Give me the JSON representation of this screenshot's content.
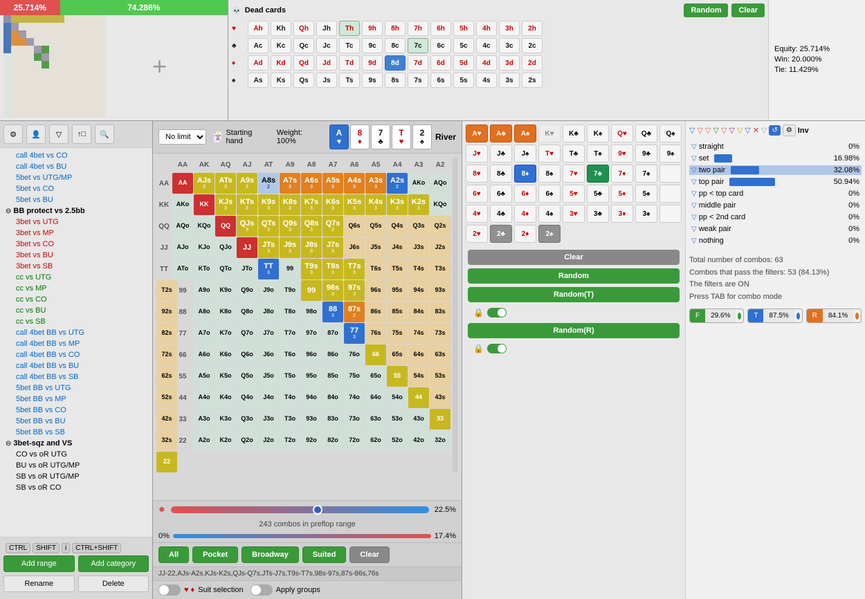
{
  "header": {
    "equity_red": "25.714%",
    "equity_green": "74.286%",
    "dead_cards_title": "Dead cards",
    "random_label": "Random",
    "clear_label": "Clear",
    "equity_label": "Equity: 25.714%",
    "win_label": "Win: 20.000%",
    "tie_label": "Tie: 11.429%"
  },
  "dead_cards": {
    "rows": [
      {
        "label": "A♠",
        "cards": [
          "Ah",
          "Kh",
          "Qh",
          "Jh",
          "Th",
          "9h",
          "8h",
          "7h",
          "6h",
          "5h",
          "4h",
          "3h",
          "2h"
        ]
      },
      {
        "label": "A♥",
        "cards": [
          "Ac",
          "Kc",
          "Qc",
          "Jc",
          "Tc",
          "9c",
          "8c",
          "7c",
          "6c",
          "5c",
          "4c",
          "3c",
          "2c"
        ]
      },
      {
        "label": "A♦",
        "cards": [
          "Ad",
          "Kd",
          "Qd",
          "Jd",
          "Td",
          "9d",
          "8d",
          "7d",
          "6d",
          "5d",
          "4d",
          "3d",
          "2d"
        ]
      },
      {
        "label": "A♣",
        "cards": [
          "As",
          "Ks",
          "Qs",
          "Js",
          "Ts",
          "9s",
          "8s",
          "7s",
          "6s",
          "5s",
          "4s",
          "3s",
          "2s"
        ]
      }
    ]
  },
  "sidebar": {
    "items": [
      {
        "label": "call 4bet vs CO",
        "class": "blue indent2"
      },
      {
        "label": "call 4bet vs BU",
        "class": "blue indent2"
      },
      {
        "label": "5bet vs UTG/MP",
        "class": "blue indent2"
      },
      {
        "label": "5bet vs CO",
        "class": "blue indent2"
      },
      {
        "label": "5bet vs BU",
        "class": "blue indent2"
      },
      {
        "label": "BB protect vs 2.5bb",
        "class": "category"
      },
      {
        "label": "3bet vs UTG",
        "class": "red indent2"
      },
      {
        "label": "3bet vs MP",
        "class": "red indent2"
      },
      {
        "label": "3bet vs CO",
        "class": "red indent2"
      },
      {
        "label": "3bet vs BU",
        "class": "red indent2"
      },
      {
        "label": "3bet vs SB",
        "class": "red indent2"
      },
      {
        "label": "cc vs UTG",
        "class": "green indent2"
      },
      {
        "label": "cc vs MP",
        "class": "green indent2"
      },
      {
        "label": "cc vs CO",
        "class": "green indent2"
      },
      {
        "label": "cc vs BU",
        "class": "green indent2"
      },
      {
        "label": "cc vs SB",
        "class": "green indent2"
      },
      {
        "label": "call 4bet BB vs UTG",
        "class": "blue indent2"
      },
      {
        "label": "call 4bet BB vs MP",
        "class": "blue indent2"
      },
      {
        "label": "call 4bet BB vs CO",
        "class": "blue indent2"
      },
      {
        "label": "call 4bet BB vs BU",
        "class": "blue indent2"
      },
      {
        "label": "call 4bet BB vs SB",
        "class": "blue indent2"
      },
      {
        "label": "5bet BB vs UTG",
        "class": "blue indent2"
      },
      {
        "label": "5bet BB vs MP",
        "class": "blue indent2"
      },
      {
        "label": "5bet BB vs CO",
        "class": "blue indent2"
      },
      {
        "label": "5bet BB vs BU",
        "class": "blue indent2"
      },
      {
        "label": "5bet BB vs SB",
        "class": "blue indent2"
      },
      {
        "label": "3bet-sqz and VS",
        "class": "category"
      },
      {
        "label": "CO vs oR UTG",
        "class": "indent2"
      },
      {
        "label": "BU vs oR UTG/MP",
        "class": "indent2"
      },
      {
        "label": "SB vs oR UTG/MP",
        "class": "indent2"
      },
      {
        "label": "SB vs oR CO",
        "class": "indent2"
      }
    ],
    "add_range": "Add range",
    "add_category": "Add category",
    "rename": "Rename",
    "delete": "Delete"
  },
  "range_editor": {
    "limit_label": "No limit",
    "starting_hand_label": "Starting hand",
    "weight_label": "Weight:",
    "weight_value": "100%",
    "river_label": "River",
    "combos_label": "243 combos in preflop range",
    "percent_label": "22.5%",
    "range_0": "0%",
    "range_17": "17.4%",
    "all_label": "All",
    "pocket_label": "Pocket",
    "broadway_label": "Broadway",
    "suited_label": "Suited",
    "clear_range_label": "Clear",
    "combo_text": "JJ-22,AJs-A2s,KJs-K2s,QJs-Q7s,JTs-J7s,T9s-T7s,98s-97s,87s-86s,76s",
    "suit_selection_label": "Suit selection",
    "apply_groups_label": "Apply groups"
  },
  "hand_grid": {
    "headers": [
      "AA",
      "AK",
      "AQ",
      "AJ",
      "AT",
      "A9",
      "A8",
      "A7",
      "A6",
      "A5",
      "A4",
      "A3",
      "A2"
    ],
    "rows_labels": [
      "AA",
      "KK",
      "QQ",
      "JJ",
      "TT",
      "99",
      "88",
      "77",
      "66",
      "55",
      "44",
      "33",
      "22"
    ],
    "cells": {
      "AA": {
        "label": "AA",
        "type": "pair",
        "color": "pair"
      },
      "AKs": {
        "label": "AJs",
        "sub": "3",
        "type": "suited",
        "color": "yellow"
      },
      "AQs": {
        "label": "ATs",
        "sub": "3",
        "type": "suited",
        "color": "yellow"
      },
      "AJs": {
        "label": "A9s",
        "sub": "3",
        "type": "suited",
        "color": "yellow"
      },
      "ATs": {
        "label": "A8s",
        "sub": "2",
        "type": "suited",
        "color": "blue-green"
      },
      "A9s": {
        "label": "A7s",
        "sub": "3",
        "type": "suited",
        "color": "orange"
      },
      "A8s": {
        "label": "A6s",
        "sub": "3",
        "type": "suited",
        "color": "orange"
      },
      "A7s": {
        "label": "A5s",
        "sub": "3",
        "type": "suited",
        "color": "orange"
      },
      "A6s": {
        "label": "A4s",
        "sub": "3",
        "type": "suited",
        "color": "orange"
      },
      "A5s": {
        "label": "A3s",
        "sub": "3",
        "type": "suited",
        "color": "orange"
      },
      "A4s": {
        "label": "A2s",
        "sub": "2",
        "type": "suited",
        "color": "blue"
      }
    }
  },
  "board": {
    "cards": [
      {
        "rank": "A",
        "suit": "♥",
        "color": "red",
        "selected": true
      },
      {
        "rank": "8",
        "suit": "♦",
        "color": "red",
        "selected": false
      },
      {
        "rank": "7",
        "suit": "♣",
        "color": "black",
        "selected": false
      },
      {
        "rank": "T",
        "suit": "♥",
        "color": "red",
        "selected": false
      },
      {
        "rank": "2",
        "suit": "♠",
        "color": "black",
        "selected": false
      }
    ]
  },
  "stats": {
    "filters": [
      "straight",
      "set",
      "two pair",
      "top pair",
      "pp < top card",
      "middle pair",
      "pp < 2nd card",
      "weak pair",
      "nothing"
    ],
    "values": {
      "straight": "0%",
      "set": "16.98%",
      "two_pair": "32.08%",
      "top_pair": "50.94%",
      "pp_top": "0%",
      "middle_pair": "0%",
      "pp_2nd": "0%",
      "weak_pair": "0%",
      "nothing": "0%"
    },
    "bars": {
      "set": 17,
      "two_pair": 32,
      "top_pair": 51
    },
    "total_combos": "Total number of combos: 63",
    "combos_pass": "Combos that pass the filters: 53 (84.13%)",
    "filters_on": "The filters are ON",
    "press_tab": "Press TAB for combo mode",
    "filter_f": "F",
    "filter_f_pct": "29.6%",
    "filter_t": "T",
    "filter_t_pct": "87.5%",
    "filter_r": "R",
    "filter_r_pct": "84.1%"
  }
}
